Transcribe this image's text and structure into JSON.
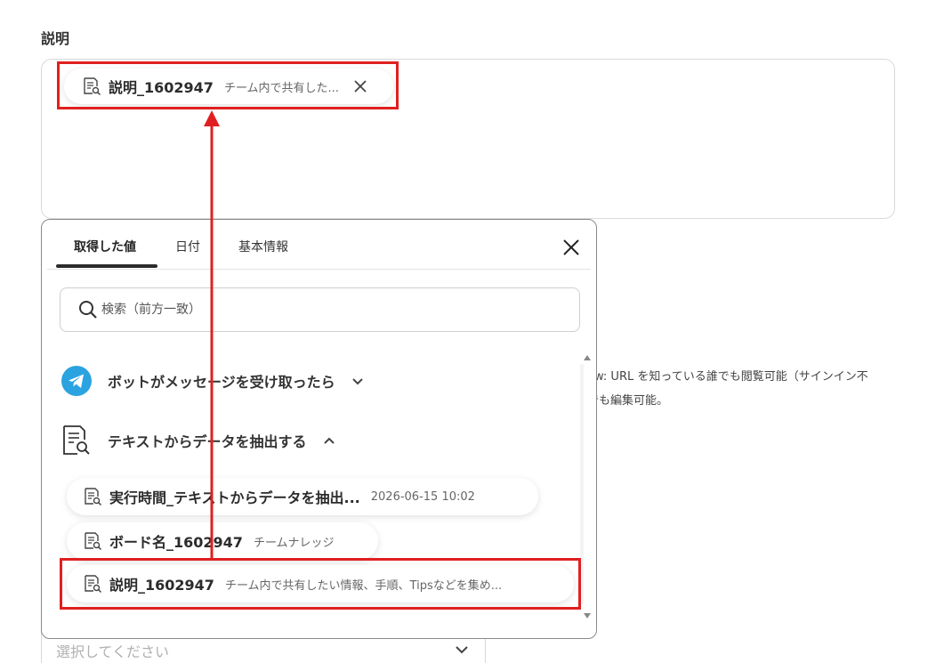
{
  "field": {
    "label": "説明"
  },
  "selected_chip": {
    "name": "説明_1602947",
    "value": "チーム内で共有した..."
  },
  "background": {
    "select_placeholder": "選択してください",
    "desc_line1": "ew: URL を知っている誰でも閲覧可能（サインイン不",
    "desc_line2": "でも編集可能。"
  },
  "popup": {
    "tabs": [
      {
        "label": "取得した値",
        "active": true
      },
      {
        "label": "日付",
        "active": false
      },
      {
        "label": "基本情報",
        "active": false
      }
    ],
    "search": {
      "placeholder": "検索（前方一致）",
      "value": ""
    },
    "groups": [
      {
        "label": "ボットがメッセージを受け取ったら",
        "icon": "telegram-icon",
        "expanded": false
      },
      {
        "label": "テキストからデータを抽出する",
        "icon": "document-search-icon",
        "expanded": true
      }
    ],
    "items": [
      {
        "name": "実行時間_テキストからデータを抽出...",
        "value": "2026-06-15 10:02"
      },
      {
        "name": "ボード名_1602947",
        "value": "チームナレッジ"
      },
      {
        "name": "説明_1602947",
        "value": "チーム内で共有したい情報、手順、Tipsなどを集め..."
      }
    ]
  },
  "colors": {
    "highlight": "#e02020",
    "telegram": "#2aa3e0",
    "text": "#2b2b2b"
  }
}
